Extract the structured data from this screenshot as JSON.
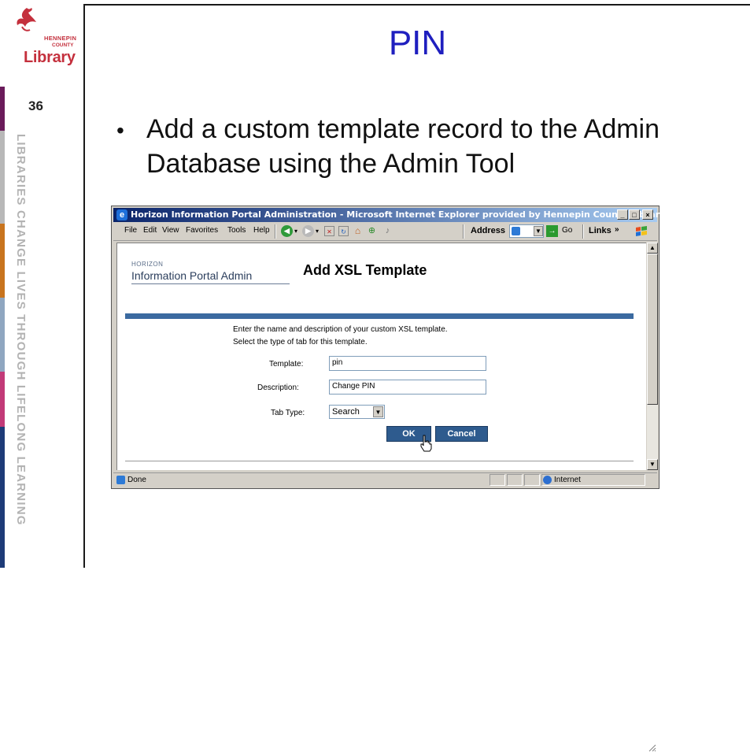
{
  "slide": {
    "number": "36",
    "title": "PIN",
    "bullet": "Add a custom template record to the Admin Database using the Admin Tool",
    "tagline": "LIBRARIES CHANGE LIVES THROUGH LIFELONG LEARNING",
    "logo": {
      "line1": "HENNEPIN",
      "line2": "COUNTY",
      "line3": "Library"
    }
  },
  "colors": {
    "title_blue": "#1f1fbf",
    "brand_red": "#c4303d",
    "ie_titlebar": "#0a246a",
    "blue_bar": "#3b6aa0",
    "button_blue": "#2e5b8e"
  },
  "browser": {
    "title": "Horizon Information Portal Administration - Microsoft Internet Explorer provided by Hennepin County Library",
    "caption_buttons": {
      "minimize": "_",
      "maximize": "□",
      "close": "×"
    },
    "menu": [
      "File",
      "Edit",
      "View",
      "Favorites",
      "Tools",
      "Help"
    ],
    "address_label": "Address",
    "go_label": "Go",
    "links_label": "Links",
    "links_chevron": "»",
    "icons": [
      "back-icon",
      "forward-icon",
      "stop-icon",
      "refresh-icon",
      "home-icon",
      "search-icon",
      "favorites-icon",
      "media-icon"
    ],
    "status_text": "Done",
    "zone_text": "Internet"
  },
  "page": {
    "brand_small": "HORIZON",
    "brand_big": "Information Portal Admin",
    "heading": "Add XSL Template",
    "instruction_1": "Enter the name and description of your custom XSL template.",
    "instruction_2": "Select the type of tab for this template.",
    "fields": {
      "template_label": "Template:",
      "template_value": "pin",
      "description_label": "Description:",
      "description_value": "Change PIN",
      "tabtype_label": "Tab Type:",
      "tabtype_value": "Search"
    },
    "ok_label": "OK",
    "cancel_label": "Cancel"
  }
}
